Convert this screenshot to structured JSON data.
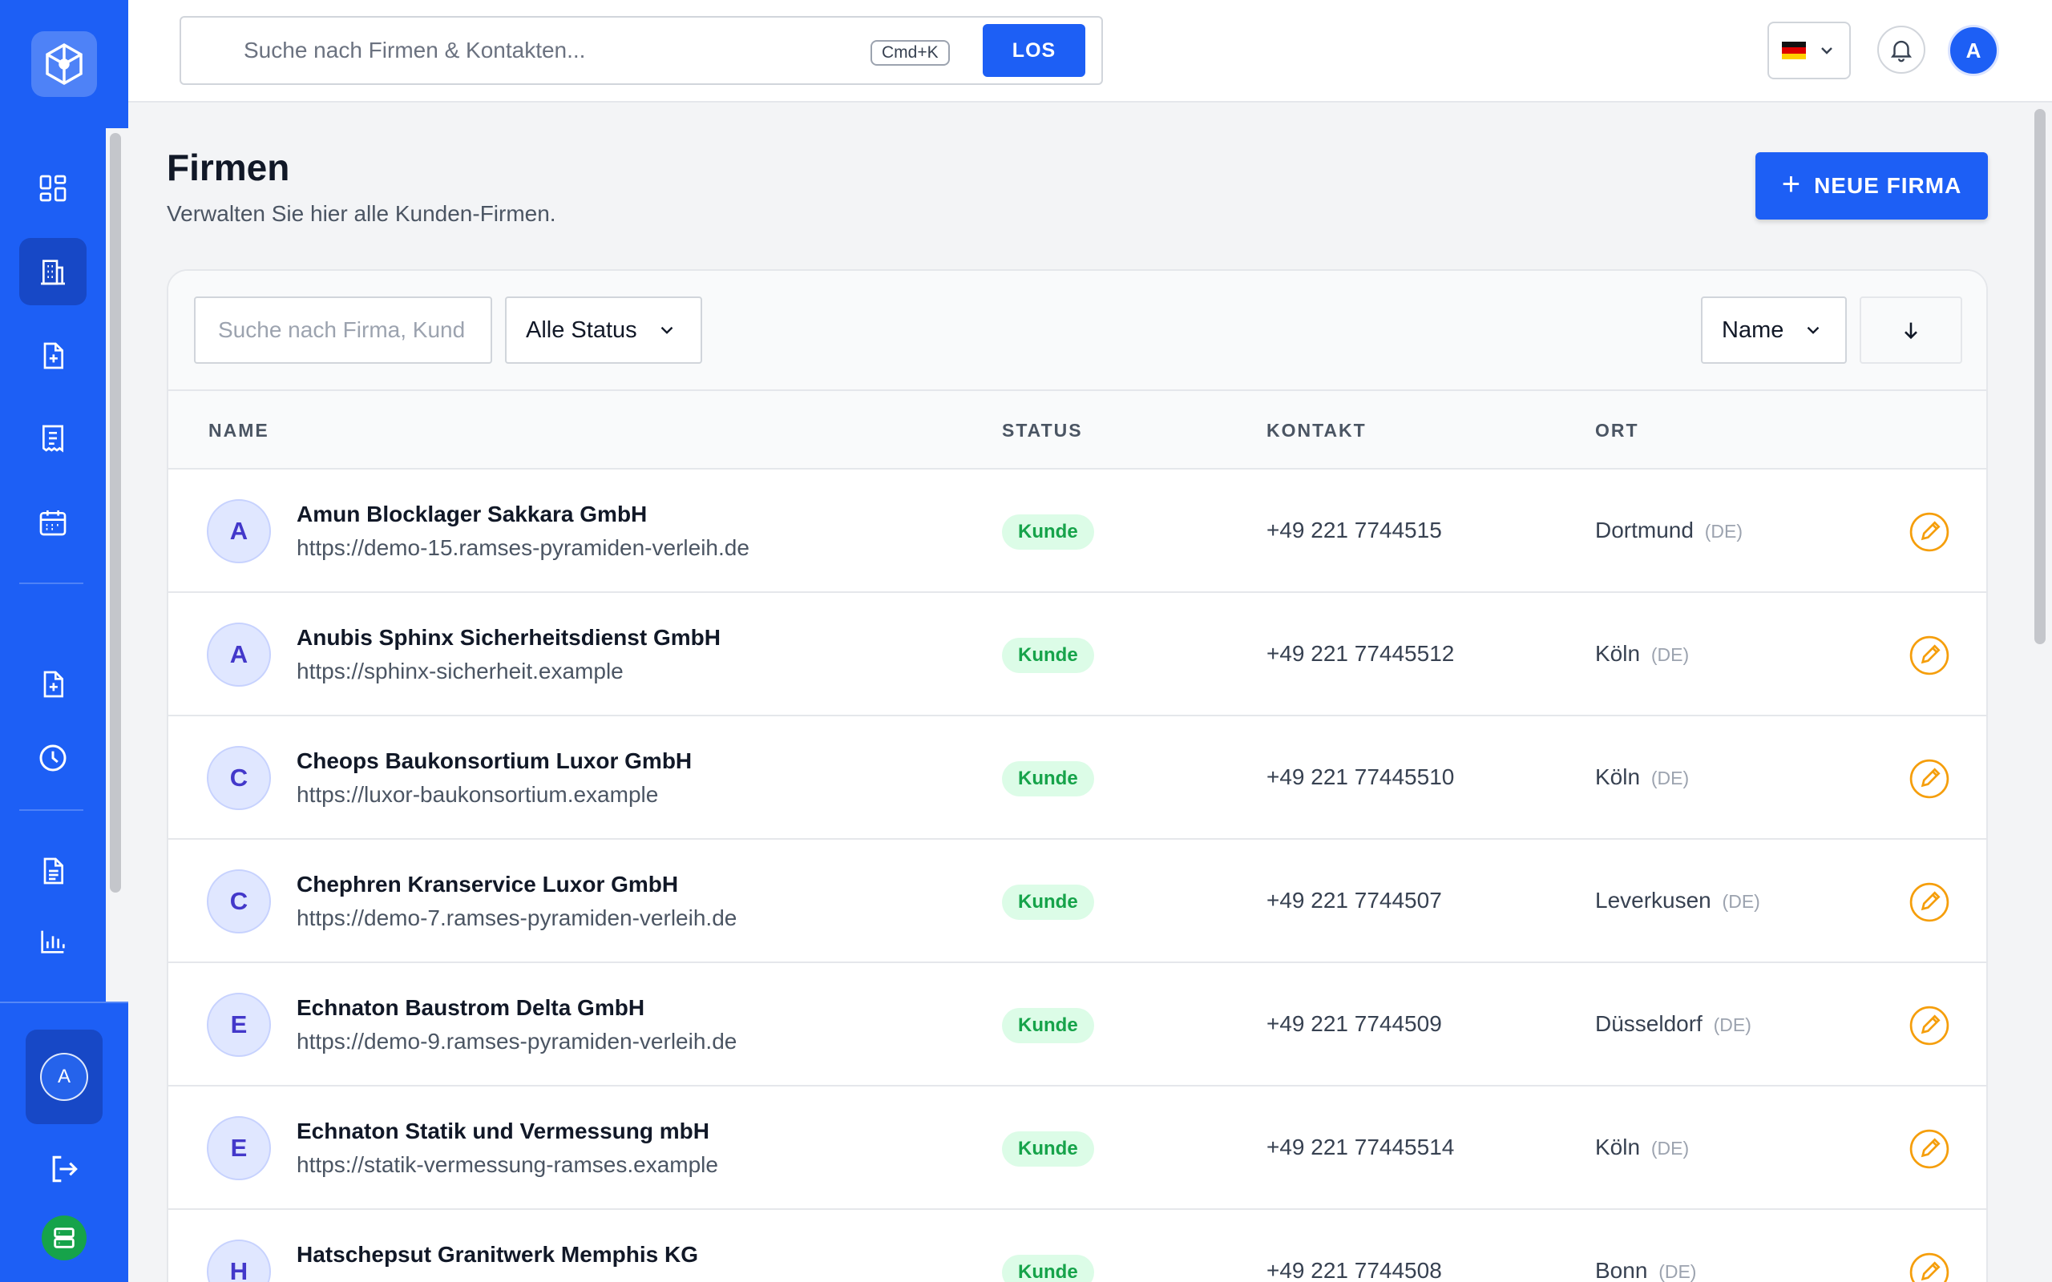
{
  "colors": {
    "primary": "#1d5ff5",
    "badge_bg": "#dcfce7",
    "badge_text": "#16a34a",
    "edit_icon": "#f59e0b"
  },
  "header": {
    "search_placeholder": "Suche nach Firmen & Kontakten...",
    "shortcut": "Cmd+K",
    "search_button": "LOS",
    "language_flag": "de-flag-icon",
    "avatar_initial": "A"
  },
  "sidebar": {
    "icons": [
      "dashboard-icon",
      "building-icon",
      "file-plus-icon",
      "receipt-icon",
      "calendar-icon",
      "file-plus-icon",
      "clock-icon",
      "document-icon",
      "chart-icon"
    ],
    "active_item": "building-icon",
    "user_initial": "A",
    "logout_icon": "logout-icon",
    "server_icon": "server-icon"
  },
  "page": {
    "title": "Firmen",
    "subtitle": "Verwalten Sie hier alle Kunden-Firmen.",
    "new_button": "NEUE FIRMA"
  },
  "filters": {
    "search_placeholder": "Suche nach Firma, Kund",
    "status_select": "Alle Status",
    "sort_select": "Name",
    "sort_direction_icon": "arrow-down-icon"
  },
  "table": {
    "headers": {
      "name": "NAME",
      "status": "STATUS",
      "contact": "KONTAKT",
      "location": "ORT"
    },
    "rows": [
      {
        "initial": "A",
        "name": "Amun Blocklager Sakkara GmbH",
        "url": "https://demo-15.ramses-pyramiden-verleih.de",
        "status": "Kunde",
        "phone": "+49 221 7744515",
        "city": "Dortmund",
        "country": "(DE)"
      },
      {
        "initial": "A",
        "name": "Anubis Sphinx Sicherheitsdienst GmbH",
        "url": "https://sphinx-sicherheit.example",
        "status": "Kunde",
        "phone": "+49 221 77445512",
        "city": "Köln",
        "country": "(DE)"
      },
      {
        "initial": "C",
        "name": "Cheops Baukonsortium Luxor GmbH",
        "url": "https://luxor-baukonsortium.example",
        "status": "Kunde",
        "phone": "+49 221 77445510",
        "city": "Köln",
        "country": "(DE)"
      },
      {
        "initial": "C",
        "name": "Chephren Kranservice Luxor GmbH",
        "url": "https://demo-7.ramses-pyramiden-verleih.de",
        "status": "Kunde",
        "phone": "+49 221 7744507",
        "city": "Leverkusen",
        "country": "(DE)"
      },
      {
        "initial": "E",
        "name": "Echnaton Baustrom Delta GmbH",
        "url": "https://demo-9.ramses-pyramiden-verleih.de",
        "status": "Kunde",
        "phone": "+49 221 7744509",
        "city": "Düsseldorf",
        "country": "(DE)"
      },
      {
        "initial": "E",
        "name": "Echnaton Statik und Vermessung mbH",
        "url": "https://statik-vermessung-ramses.example",
        "status": "Kunde",
        "phone": "+49 221 77445514",
        "city": "Köln",
        "country": "(DE)"
      },
      {
        "initial": "H",
        "name": "Hatschepsut Granitwerk Memphis KG",
        "url": "",
        "status": "Kunde",
        "phone": "+49 221 7744508",
        "city": "Bonn",
        "country": "(DE)"
      }
    ]
  }
}
